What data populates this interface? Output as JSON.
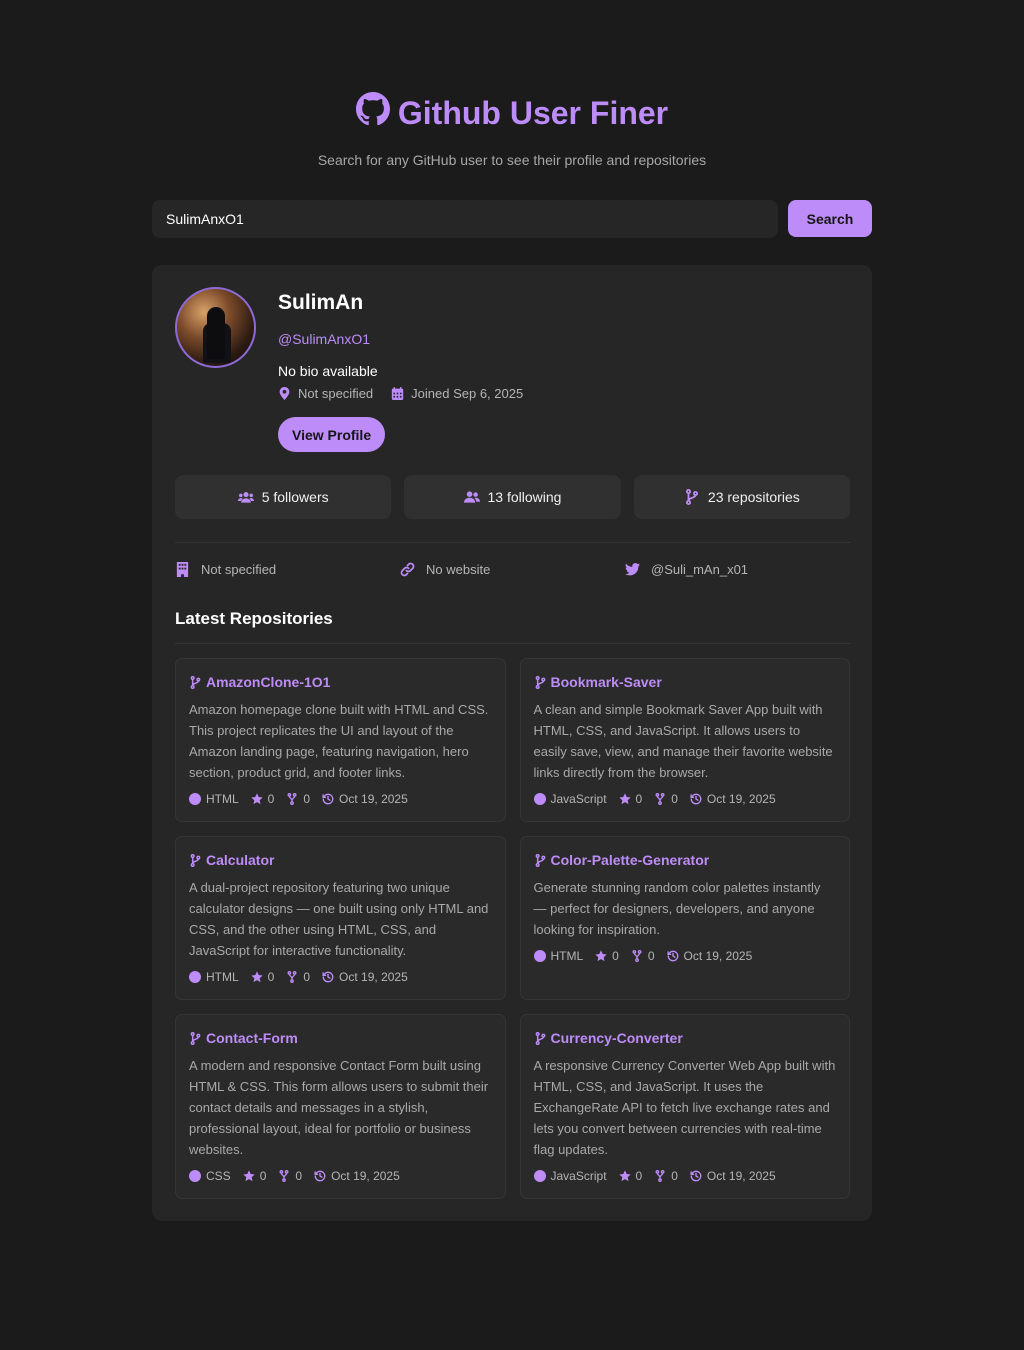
{
  "header": {
    "title": "Github User Finer",
    "subtitle": "Search for any GitHub user to see their profile and repositories"
  },
  "search": {
    "value": "SulimAnxO1",
    "button_label": "Search"
  },
  "profile": {
    "name": "SulimAn",
    "login": "@SulimAnxO1",
    "bio": "No bio available",
    "location": "Not specified",
    "joined": "Joined Sep 6, 2025",
    "view_button": "View Profile"
  },
  "stats": {
    "followers": "5 followers",
    "following": "13 following",
    "repositories": "23 repositories"
  },
  "extra": {
    "company": "Not specified",
    "website": "No website",
    "twitter": "@Suli_mAn_x01"
  },
  "section": {
    "title": "Latest Repositories"
  },
  "repos": [
    {
      "name": "AmazonClone-1O1",
      "description": "Amazon homepage clone built with HTML and CSS. This project replicates the UI and layout of the Amazon landing page, featuring navigation, hero section, product grid, and footer links.",
      "language": "HTML",
      "stars": "0",
      "forks": "0",
      "updated": "Oct 19, 2025"
    },
    {
      "name": "Bookmark-Saver",
      "description": "A clean and simple Bookmark Saver App built with HTML, CSS, and JavaScript. It allows users to easily save, view, and manage their favorite website links directly from the browser.",
      "language": "JavaScript",
      "stars": "0",
      "forks": "0",
      "updated": "Oct 19, 2025"
    },
    {
      "name": "Calculator",
      "description": "A dual-project repository featuring two unique calculator designs — one built using only HTML and CSS, and the other using HTML, CSS, and JavaScript for interactive functionality.",
      "language": "HTML",
      "stars": "0",
      "forks": "0",
      "updated": "Oct 19, 2025"
    },
    {
      "name": "Color-Palette-Generator",
      "description": "Generate stunning random color palettes instantly — perfect for designers, developers, and anyone looking for inspiration.",
      "language": "HTML",
      "stars": "0",
      "forks": "0",
      "updated": "Oct 19, 2025"
    },
    {
      "name": "Contact-Form",
      "description": "A modern and responsive Contact Form built using HTML & CSS. This form allows users to submit their contact details and messages in a stylish, professional layout, ideal for portfolio or business websites.",
      "language": "CSS",
      "stars": "0",
      "forks": "0",
      "updated": "Oct 19, 2025"
    },
    {
      "name": "Currency-Converter",
      "description": "A responsive Currency Converter Web App built with HTML, CSS, and JavaScript. It uses the ExchangeRate API to fetch live exchange rates and lets you convert between currencies with real-time flag updates.",
      "language": "JavaScript",
      "stars": "0",
      "forks": "0",
      "updated": "Oct 19, 2025"
    }
  ],
  "icons": {
    "title": "github-icon",
    "location": "map-pin-icon",
    "joined": "calendar-icon",
    "followers": "users-icon",
    "following": "user-friends-icon",
    "repositories": "code-branch-icon",
    "company": "building-icon",
    "website": "link-icon",
    "twitter": "twitter-icon",
    "stars": "star-icon",
    "forks": "fork-icon",
    "updated": "history-icon"
  },
  "colors": {
    "accent": "#bd8cf8",
    "background": "#1b1b1b",
    "card": "#262626"
  }
}
